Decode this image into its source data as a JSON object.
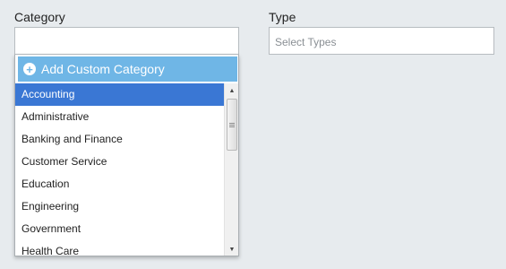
{
  "category": {
    "label": "Category",
    "value": "",
    "add_custom_label": "Add Custom Category",
    "options": [
      {
        "label": "Accounting",
        "selected": true
      },
      {
        "label": "Administrative",
        "selected": false
      },
      {
        "label": "Banking and Finance",
        "selected": false
      },
      {
        "label": "Customer Service",
        "selected": false
      },
      {
        "label": "Education",
        "selected": false
      },
      {
        "label": "Engineering",
        "selected": false
      },
      {
        "label": "Government",
        "selected": false
      },
      {
        "label": "Health Care",
        "selected": false
      }
    ]
  },
  "type": {
    "label": "Type",
    "placeholder": "Select Types"
  },
  "icons": {
    "add": "plus-circle-icon",
    "scroll_up": "triangle-up-icon",
    "scroll_down": "triangle-down-icon"
  },
  "colors": {
    "background": "#e7ebee",
    "add_custom_bg": "#6fb6e6",
    "selected_bg": "#3a77d4"
  }
}
